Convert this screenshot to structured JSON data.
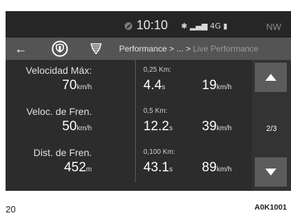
{
  "status": {
    "clock": "10:10",
    "signal_text": "✱ ↓❘❙❚ 4G ▮",
    "compass": "NW"
  },
  "toolbar": {
    "back_symbol": "←",
    "breadcrumb_main": "Performance > ... > ",
    "breadcrumb_current": "Live Performance"
  },
  "rows": [
    {
      "label": "Velocidad Máx:",
      "value": "70",
      "value_unit": "km/h",
      "condition": "0,25 Km:",
      "time": "4.4",
      "time_unit": "s",
      "speed": "19",
      "speed_unit": "km/h"
    },
    {
      "label": "Veloc. de Fren.",
      "value": "50",
      "value_unit": "km/h",
      "condition": "0,5 Km:",
      "time": "12.2",
      "time_unit": "s",
      "speed": "39",
      "speed_unit": "km/h"
    },
    {
      "label": "Dist. de Fren.",
      "value": "452",
      "value_unit": "m",
      "condition": "0,100 Km:",
      "time": "43.1",
      "time_unit": "s",
      "speed": "89",
      "speed_unit": "km/h"
    }
  ],
  "pager": {
    "indicator": "2/3"
  },
  "footer": {
    "page_number": "20",
    "code": "A0K1001"
  },
  "colors": {
    "screen_bg": "#2c2c2c",
    "toolbar_bg": "#545454",
    "button_bg": "#5c5c5c"
  }
}
